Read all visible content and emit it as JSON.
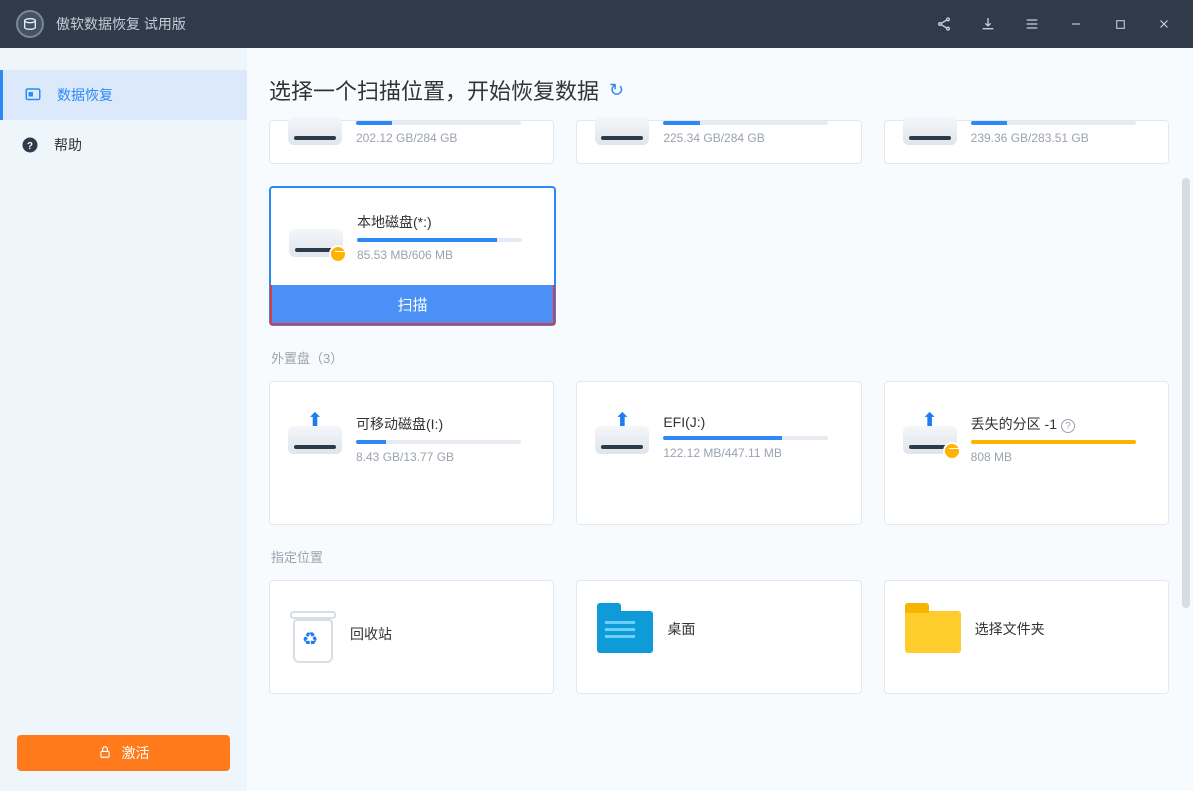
{
  "app": {
    "title": "傲软数据恢复 试用版"
  },
  "sidebar": {
    "items": [
      {
        "label": "数据恢复"
      },
      {
        "label": "帮助"
      }
    ],
    "activate": "激活"
  },
  "page": {
    "title": "选择一个扫描位置，开始恢复数据",
    "scan_label": "扫描",
    "section_external": "外置盘（3）",
    "section_location": "指定位置"
  },
  "topDrives": [
    {
      "usage": "202.12 GB/284 GB",
      "fill": 19
    },
    {
      "usage": "225.34 GB/284 GB",
      "fill": 19
    },
    {
      "usage": "239.36 GB/283.51 GB",
      "fill": 19
    }
  ],
  "selectedDrive": {
    "name": "本地磁盘(*:)",
    "usage": "85.53 MB/606 MB",
    "fill": 85
  },
  "externalDrives": [
    {
      "name": "可移动磁盘(I:)",
      "usage": "8.43 GB/13.77 GB",
      "fill": 18
    },
    {
      "name": "EFI(J:)",
      "usage": "122.12 MB/447.11 MB",
      "fill": 72
    },
    {
      "name": "丢失的分区 -1",
      "usage": "808 MB",
      "fill": 100,
      "lost": true
    }
  ],
  "locations": [
    {
      "name": "回收站"
    },
    {
      "name": "桌面"
    },
    {
      "name": "选择文件夹"
    }
  ]
}
